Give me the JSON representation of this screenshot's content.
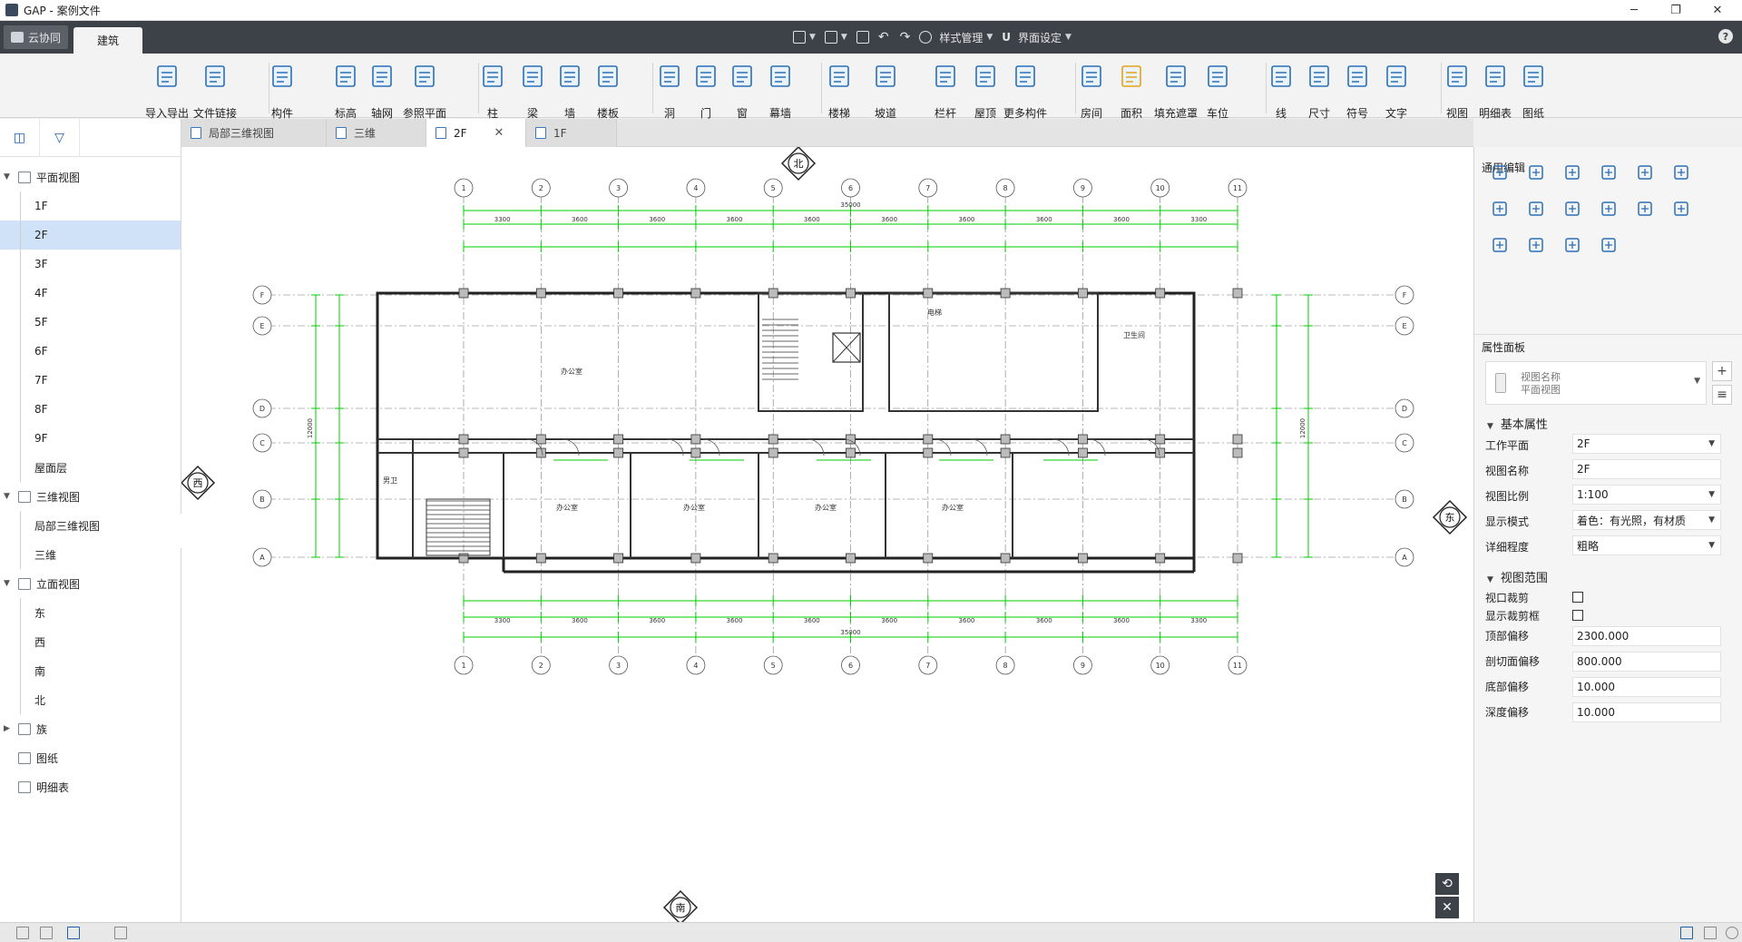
{
  "window": {
    "title": "GAP - 案例文件",
    "controls": [
      "─",
      "❐",
      "✕"
    ]
  },
  "ribbon": {
    "cloud_tab": "云协同",
    "active_tab": "建筑",
    "quick_access": {
      "style_manage": "样式管理",
      "ui_settings": "界面设定"
    },
    "help": "?"
  },
  "tools": [
    {
      "id": "import-export",
      "label": "导入导出",
      "icon": "cad-import-icon",
      "color": "#2a6fb8"
    },
    {
      "id": "file-link",
      "label": "文件链接",
      "icon": "file-link-icon",
      "color": "#2a6fb8"
    },
    {
      "id": "component",
      "label": "构件",
      "icon": "component-icon",
      "color": "#2a6fb8"
    },
    {
      "id": "elevation",
      "label": "标高",
      "icon": "elevation-icon",
      "color": "#2a6fb8"
    },
    {
      "id": "grid",
      "label": "轴网",
      "icon": "axis-grid-icon",
      "color": "#2a6fb8"
    },
    {
      "id": "ref-plane",
      "label": "参照平面",
      "icon": "reference-plane-icon",
      "color": "#2a6fb8"
    },
    {
      "id": "column",
      "label": "柱",
      "icon": "column-icon",
      "color": "#2a6fb8"
    },
    {
      "id": "beam",
      "label": "梁",
      "icon": "beam-icon",
      "color": "#2a6fb8"
    },
    {
      "id": "wall",
      "label": "墙",
      "icon": "wall-icon",
      "color": "#2a6fb8"
    },
    {
      "id": "slab",
      "label": "楼板",
      "icon": "slab-icon",
      "color": "#2a6fb8"
    },
    {
      "id": "opening",
      "label": "洞",
      "icon": "opening-icon",
      "color": "#2a6fb8"
    },
    {
      "id": "door",
      "label": "门",
      "icon": "door-icon",
      "color": "#2a6fb8"
    },
    {
      "id": "window",
      "label": "窗",
      "icon": "window-icon",
      "color": "#2a6fb8"
    },
    {
      "id": "curtain-wall",
      "label": "幕墙",
      "icon": "curtain-wall-icon",
      "color": "#2a6fb8"
    },
    {
      "id": "stair",
      "label": "楼梯",
      "icon": "stair-icon",
      "color": "#2a6fb8"
    },
    {
      "id": "ramp",
      "label": "坡道",
      "icon": "ramp-icon",
      "color": "#2a6fb8"
    },
    {
      "id": "railing",
      "label": "栏杆",
      "icon": "railing-icon",
      "color": "#2a6fb8"
    },
    {
      "id": "roof",
      "label": "屋顶",
      "icon": "roof-icon",
      "color": "#2a6fb8"
    },
    {
      "id": "more-components",
      "label": "更多构件",
      "icon": "more-components-icon",
      "color": "#2a6fb8"
    },
    {
      "id": "room",
      "label": "房间",
      "icon": "room-icon",
      "color": "#2a6fb8"
    },
    {
      "id": "area",
      "label": "面积",
      "icon": "area-icon",
      "color": "#e3a21a"
    },
    {
      "id": "fill-mask",
      "label": "填充遮罩",
      "icon": "fill-mask-icon",
      "color": "#2a6fb8"
    },
    {
      "id": "parking",
      "label": "车位",
      "icon": "parking-icon",
      "color": "#2a6fb8"
    },
    {
      "id": "line",
      "label": "线",
      "icon": "line-icon",
      "color": "#2a6fb8"
    },
    {
      "id": "dimension",
      "label": "尺寸",
      "icon": "dimension-icon",
      "color": "#2a6fb8"
    },
    {
      "id": "symbol",
      "label": "符号",
      "icon": "symbol-icon",
      "color": "#2a6fb8"
    },
    {
      "id": "text",
      "label": "文字",
      "icon": "text-icon",
      "color": "#2a6fb8"
    },
    {
      "id": "view",
      "label": "视图",
      "icon": "view-icon",
      "color": "#2a6fb8"
    },
    {
      "id": "schedule",
      "label": "明细表",
      "icon": "schedule-icon",
      "color": "#2a6fb8"
    },
    {
      "id": "sheet",
      "label": "图纸",
      "icon": "sheet-icon",
      "color": "#2a6fb8"
    }
  ],
  "tree": [
    {
      "label": "平面视图",
      "level": 0,
      "toggle": "v",
      "icon": true
    },
    {
      "label": "1F",
      "level": 1
    },
    {
      "label": "2F",
      "level": 1,
      "selected": true
    },
    {
      "label": "3F",
      "level": 1
    },
    {
      "label": "4F",
      "level": 1
    },
    {
      "label": "5F",
      "level": 1
    },
    {
      "label": "6F",
      "level": 1
    },
    {
      "label": "7F",
      "level": 1
    },
    {
      "label": "8F",
      "level": 1
    },
    {
      "label": "9F",
      "level": 1
    },
    {
      "label": "屋面层",
      "level": 1
    },
    {
      "label": "三维视图",
      "level": 0,
      "toggle": "v",
      "icon": true
    },
    {
      "label": "局部三维视图",
      "level": 1
    },
    {
      "label": "三维",
      "level": 1
    },
    {
      "label": "立面视图",
      "level": 0,
      "toggle": "v",
      "icon": true
    },
    {
      "label": "东",
      "level": 1
    },
    {
      "label": "西",
      "level": 1
    },
    {
      "label": "南",
      "level": 1
    },
    {
      "label": "北",
      "level": 1
    },
    {
      "label": "族",
      "level": 0,
      "toggle": ">",
      "icon": true
    },
    {
      "label": "图纸",
      "level": 0,
      "icon": true
    },
    {
      "label": "明细表",
      "level": 0,
      "icon": true
    }
  ],
  "doc_tabs": [
    {
      "label": "局部三维视图",
      "active": false
    },
    {
      "label": "三维",
      "active": false
    },
    {
      "label": "2F",
      "active": true,
      "closable": true
    },
    {
      "label": "1F",
      "active": false
    }
  ],
  "canvas": {
    "north": "北",
    "south": "南",
    "east": "东",
    "west": "西",
    "grid_top": [
      "1",
      "2",
      "3",
      "4",
      "5",
      "6",
      "7",
      "8",
      "9",
      "10",
      "11"
    ],
    "grid_side": [
      "F",
      "E",
      "D",
      "C",
      "B",
      "A"
    ],
    "rooms": [
      "办公室",
      "办公室",
      "办公室",
      "办公室",
      "办公室",
      "卫生间",
      "男卫",
      "电梯"
    ],
    "overall_dim": "35000",
    "bay_dims_top": [
      "3300",
      "3600",
      "3600",
      "3600",
      "3600",
      "3600",
      "3600",
      "3600",
      "3600",
      "3300"
    ],
    "side_dims": [
      "12000",
      "12000"
    ]
  },
  "right_panel": {
    "general_edit_title": "通用编辑",
    "properties_title": "属性面板",
    "view_type_line1": "视图名称",
    "view_type_line2": "平面视图",
    "basic_props_title": "基本属性",
    "basic_props": [
      {
        "label": "工作平面",
        "value": "2F",
        "dropdown": true
      },
      {
        "label": "视图名称",
        "value": "2F",
        "dropdown": false
      },
      {
        "label": "视图比例",
        "value": "1:100",
        "dropdown": true
      },
      {
        "label": "显示模式",
        "value": "着色：有光照，有材质",
        "dropdown": true
      },
      {
        "label": "详细程度",
        "value": "粗略",
        "dropdown": true
      }
    ],
    "view_range_title": "视图范围",
    "view_range_checks": [
      {
        "label": "视口裁剪",
        "checked": false
      },
      {
        "label": "显示裁剪框",
        "checked": false
      }
    ],
    "view_range_props": [
      {
        "label": "顶部偏移",
        "value": "2300.000"
      },
      {
        "label": "剖切面偏移",
        "value": "800.000"
      },
      {
        "label": "底部偏移",
        "value": "10.000"
      },
      {
        "label": "深度偏移",
        "value": "10.000"
      }
    ]
  },
  "colors": {
    "ribbon_dark": "#3d4148",
    "accent_blue": "#2a6fb8",
    "selection": "#cfe2f7",
    "dim_green": "#00cc00"
  }
}
